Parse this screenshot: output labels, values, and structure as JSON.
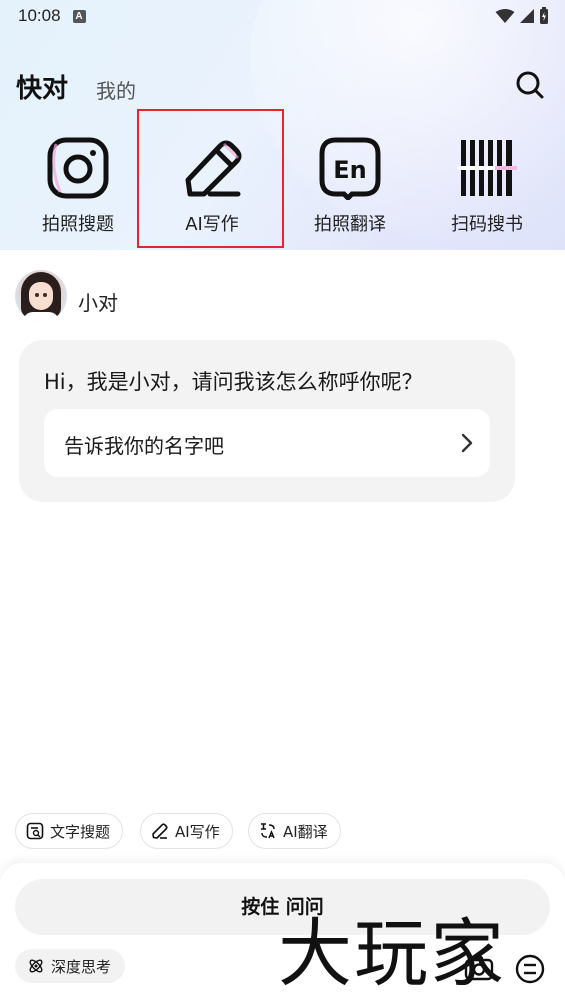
{
  "status_bar": {
    "time": "10:08",
    "notification_badge": "A"
  },
  "header": {
    "title": "快对",
    "tab_mine": "我的",
    "search_icon": "search-icon"
  },
  "quick_actions": [
    {
      "label": "拍照搜题",
      "icon": "camera-icon"
    },
    {
      "label": "AI写作",
      "icon": "pencil-icon"
    },
    {
      "label": "拍照翻译",
      "icon": "translate-icon"
    },
    {
      "label": "扫码搜书",
      "icon": "barcode-icon"
    }
  ],
  "chat": {
    "assistant_name": "小对",
    "message": "Hi，我是小对，请问我该怎么称呼你呢？",
    "option": "告诉我你的名字吧"
  },
  "chips": [
    {
      "label": "文字搜题",
      "icon": "text-search-icon"
    },
    {
      "label": "AI写作",
      "icon": "pencil-icon"
    },
    {
      "label": "AI翻译",
      "icon": "translate-icon"
    }
  ],
  "bottom": {
    "hold_button": "按住 问问",
    "deep_think": "深度思考"
  },
  "watermark": "大玩家",
  "colors": {
    "highlight": "#e0282e",
    "top_gradient": "#e4f2fb"
  }
}
